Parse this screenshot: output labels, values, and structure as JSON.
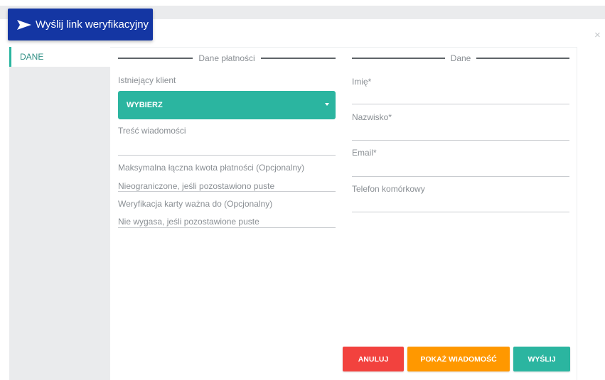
{
  "header": {
    "button_label": "Wyślij link weryfikacyjny",
    "icon": "send-icon"
  },
  "close": {
    "glyph": "×"
  },
  "sidebar": {
    "items": [
      {
        "label": "DANE"
      }
    ]
  },
  "payment_section": {
    "title": "Dane płatności",
    "existing_client_label": "Istniejący klient",
    "select_value": "WYBIERZ",
    "message_label": "Treść wiadomości",
    "message_value": "",
    "max_amount_label": "Maksymalna łączna kwota płatności (Opcjonalny)",
    "max_amount_placeholder": "Nieograniczone, jeśli pozostawiono puste",
    "card_valid_label": "Weryfikacja karty ważna do (Opcjonalny)",
    "card_valid_placeholder": "Nie wygasa, jeśli pozostawione puste"
  },
  "data_section": {
    "title": "Dane",
    "first_name_label": "Imię*",
    "last_name_label": "Nazwisko*",
    "email_label": "Email*",
    "phone_label": "Telefon komórkowy"
  },
  "actions": {
    "cancel_label": "ANULUJ",
    "preview_label": "POKAŻ WIADOMOŚĆ",
    "send_label": "WYŚLIJ"
  },
  "colors": {
    "header_blue": "#1436a3",
    "teal": "#2bb5a0",
    "cancel_red": "#f2423e",
    "preview_orange": "#ff9800",
    "send_teal": "#2bb5a0"
  }
}
